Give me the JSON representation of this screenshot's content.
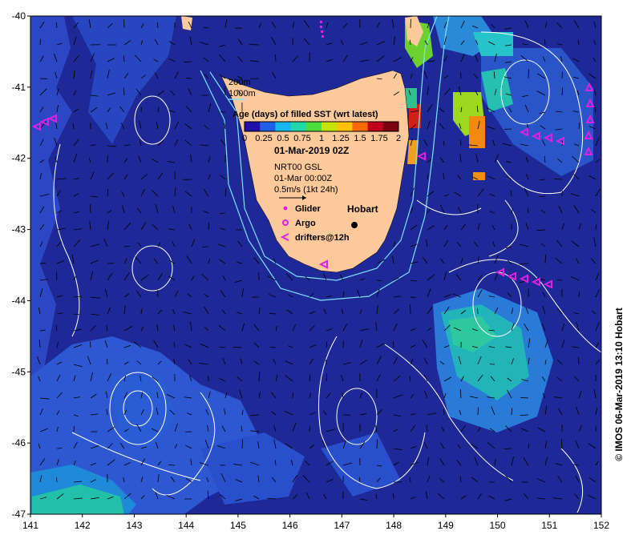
{
  "axes": {
    "lon_ticks": [
      "141",
      "142",
      "143",
      "144",
      "145",
      "146",
      "147",
      "148",
      "149",
      "150",
      "151",
      "152"
    ],
    "lat_ticks": [
      "-40",
      "-41",
      "-42",
      "-43",
      "-44",
      "-45",
      "-46",
      "-47"
    ],
    "lon_range": [
      141,
      152
    ],
    "lat_range": [
      -47,
      -40
    ]
  },
  "legend": {
    "depth_200": "200m",
    "depth_1000": "1000m",
    "colorbar_title": "Age (days) of filled SST (wrt latest)",
    "colorbar_ticks": [
      "0",
      "0.25",
      "0.5",
      "0.75",
      "1",
      "1.25",
      "1.5",
      "1.75",
      "2"
    ],
    "colorbar_range": [
      0,
      2
    ],
    "colorbar_colors": [
      "#1e10a8",
      "#1f5ee6",
      "#19b6ee",
      "#22d8a8",
      "#4cdc3c",
      "#c7e400",
      "#ffc200",
      "#ff6a00",
      "#c0001c",
      "#7a0010"
    ],
    "date": "01-Mar-2019 02Z",
    "model": "NRT00 GSL",
    "model_time": "01-Mar 00:00Z",
    "vector_scale": "0.5m/s (1kt 24h)",
    "glider": "Glider",
    "argo": "Argo",
    "drifters": "drifters@12h"
  },
  "places": {
    "hobart": "Hobart"
  },
  "credit": "© IMOS 06-Mar-2019 13:10 Hobart",
  "colors": {
    "ocean_dark": "#1a1e8c",
    "ocean_mid": "#2a3db8",
    "ocean_light": "#2e64d8",
    "land": "#fcc99a",
    "glider": "#e020e0",
    "drifter": "#e020e0",
    "contour": "#ffffff",
    "isobath": "#7fe0ff"
  }
}
